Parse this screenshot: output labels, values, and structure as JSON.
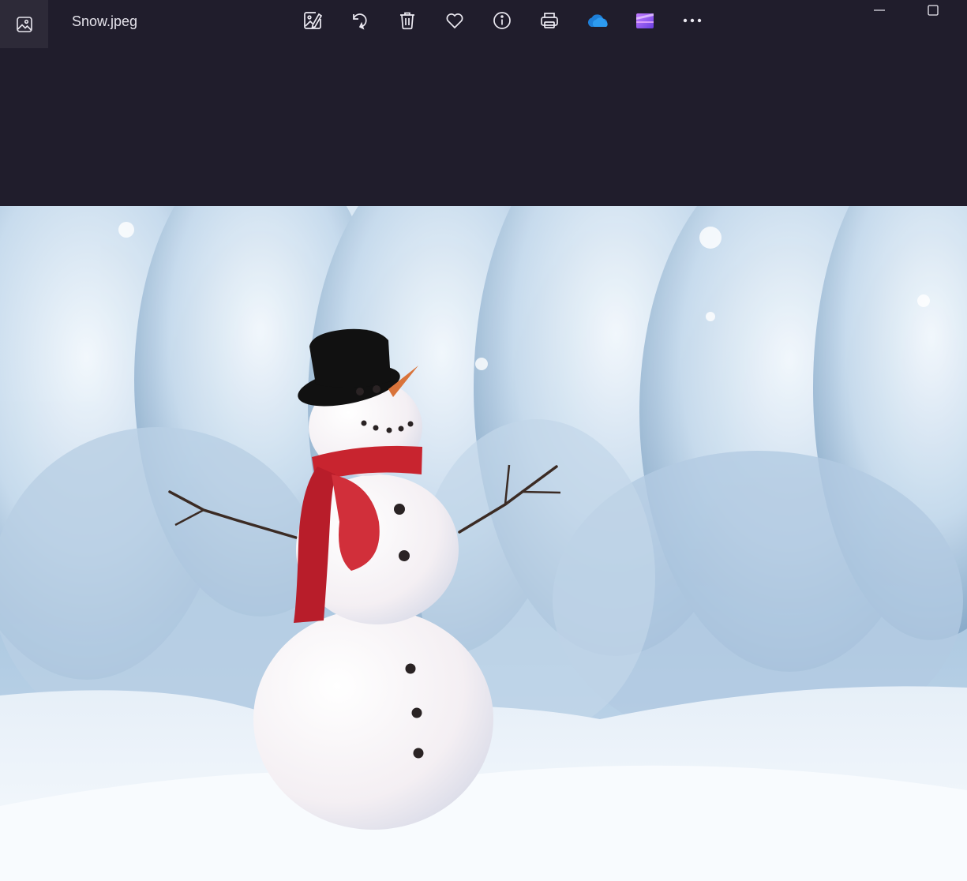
{
  "window": {
    "file_name": "Snow.jpeg"
  },
  "toolbar": {
    "items": [
      {
        "icon": "edit-image-icon"
      },
      {
        "icon": "rotate-icon"
      },
      {
        "icon": "delete-icon"
      },
      {
        "icon": "favorite-heart-icon"
      },
      {
        "icon": "info-icon"
      },
      {
        "icon": "print-icon"
      },
      {
        "icon": "onedrive-cloud-icon"
      },
      {
        "icon": "clipchamp-icon"
      },
      {
        "icon": "more-options-icon"
      }
    ]
  },
  "colors": {
    "chrome_background": "#201d2c",
    "app_icon_background": "#2d2a38",
    "onedrive_blue": "#1e7fd8",
    "clipchamp_purple": "#8b4fe6",
    "scarf_red": "#c8242f",
    "hat_black": "#111111"
  },
  "photo": {
    "subject": "snowman-in-snowy-forest"
  }
}
